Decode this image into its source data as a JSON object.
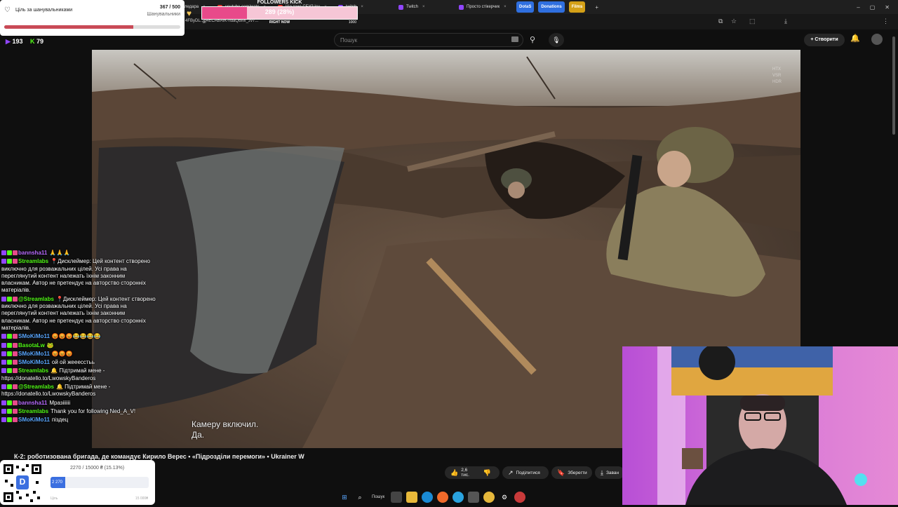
{
  "browser": {
    "tabs": [
      {
        "label": "",
        "color": "#2e7d32"
      },
      {
        "label": "",
        "color": "#3a3a3a"
      },
      {
        "label": "З поля: ССО: робо",
        "color": "#e53935"
      },
      {
        "label": "Пекло Вугледара",
        "color": "#e53935"
      },
      {
        "label": "youtube.com/watc",
        "color": "#e53935"
      },
      {
        "label": "Що таке СБУ? Існ",
        "color": "#e53935"
      },
      {
        "label": "twitch",
        "color": "#9146ff"
      },
      {
        "label": "Twitch",
        "color": "#9146ff"
      },
      {
        "label": "Просто стікерчик",
        "color": "#9146ff"
      },
      {
        "label": "DotaS",
        "color": "#2f6fdf"
      },
      {
        "label": "Donations",
        "color": "#2f6fdf"
      },
      {
        "label": "Films",
        "color": "#d4a017"
      }
    ],
    "new_tab": "+",
    "window_controls": [
      "–",
      "▢",
      "✕"
    ],
    "address_fragment": "4FByDL...g4ECABAIK-ndaQBMf_zv7..."
  },
  "youtube": {
    "search_placeholder": "Пошук",
    "create_label": "Створити",
    "video_title": "К-2: роботизована бригада, де командує Кирило Верес • «Підрозділи перемоги» • Ukrainer W",
    "subtitle_line1": "Камеру включил.",
    "subtitle_line2": "Да.",
    "watermark": "HTX\nVSR\nHDR",
    "like_count": "2,6 тис.",
    "share_label": "Поділитися",
    "save_label": "Зберегти",
    "download_label": "Заван",
    "icons": {
      "search": "search-icon",
      "mic": "mic-icon",
      "bell": "bell-icon",
      "like": "thumbs-up-icon",
      "dislike": "thumbs-down-icon",
      "share": "share-icon",
      "save": "bookmark-icon",
      "download": "download-icon"
    }
  },
  "follower_goal": {
    "title": "Ціль за шанувальниками",
    "count": "367 / 500",
    "unit": "Шанувальники",
    "progress": 0.734,
    "color": "#c94a57"
  },
  "follow_kick": {
    "label": "FOLLOWERS KICK",
    "value": "289 (28%)",
    "progress": 0.289,
    "right_now": "RIGHT NOW",
    "max": "1000",
    "zero": "0"
  },
  "stream_stats": {
    "viewers": "193",
    "likes": "79"
  },
  "chat": [
    {
      "user": "bannsha11",
      "color": "#b86bff",
      "text": "🙏🙏🙏"
    },
    {
      "user": "Streamlabs",
      "color": "#53fc18",
      "text": "📍Дисклеймер: Цей контент створено виключно для розважальних цілей. Усі права на переглянутий контент належать їхнім законним власникам. Автор не претендує на авторство сторонніх матеріалів."
    },
    {
      "user": "@Streamlabs",
      "color": "#53fc18",
      "text": "📍Дисклеймер: Цей контент створено виключно для розважальних цілей. Усі права на переглянутий контент належать їхнім законним власникам. Автор не претендує на авторство сторонніх матеріалів."
    },
    {
      "user": "SMoKiMo11",
      "color": "#5aa7ff",
      "text": "😡😡😡😂😂😂😂"
    },
    {
      "user": "BasotaLw",
      "color": "#53fc18",
      "text": "🐸"
    },
    {
      "user": "SMoKiMo11",
      "color": "#5aa7ff",
      "text": "😡😡😡"
    },
    {
      "user": "SMoKiMo11",
      "color": "#5aa7ff",
      "text": "ой ой жееесстьь"
    },
    {
      "user": "Streamlabs",
      "color": "#53fc18",
      "text": "🔔 Підтримай мене - https://donatello.to/LwowskyBanderos"
    },
    {
      "user": "@Streamlabs",
      "color": "#53fc18",
      "text": "🔔 Підтримай мене - https://donatello.to/LwowskyBanderos"
    },
    {
      "user": "bannsha11",
      "color": "#b86bff",
      "text": "Мразіііііі"
    },
    {
      "user": "Streamlabs",
      "color": "#53fc18",
      "text": "Thank you for following Ned_A_V!"
    },
    {
      "user": "SMoKiMo11",
      "color": "#5aa7ff",
      "text": "піздец"
    }
  ],
  "donation": {
    "summary": "2270 / 15000 ₴ (15.13%)",
    "fill_label": "2 270",
    "progress": 0.1513,
    "min_label": "Ціль",
    "max_label": "15 000₴",
    "qr_letter": "D"
  },
  "taskbar": {
    "search_label": "Пошук",
    "icons": [
      "windows-icon",
      "taskview-icon",
      "folder-icon",
      "edge-icon",
      "firefox-icon",
      "telegram-icon",
      "calculator-icon",
      "chrome-icon",
      "settings-icon",
      "app-icon"
    ]
  }
}
